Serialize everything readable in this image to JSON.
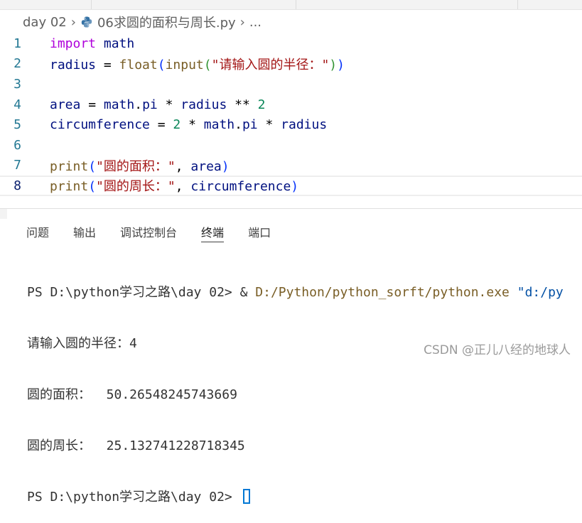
{
  "breadcrumb": {
    "folder": "day 02",
    "file": "06求圆的面积与周长.py",
    "ellipsis": "..."
  },
  "editor": {
    "current_line": 8,
    "lines": [
      {
        "number": "1"
      },
      {
        "number": "2"
      },
      {
        "number": "3"
      },
      {
        "number": "4"
      },
      {
        "number": "5"
      },
      {
        "number": "6"
      },
      {
        "number": "7"
      },
      {
        "number": "8"
      }
    ],
    "tokens": {
      "import": "import",
      "math": "math",
      "radius": "radius",
      "eq": " = ",
      "float": "float",
      "lp": "(",
      "rp": ")",
      "input": "input",
      "prompt": "\"请输入圆的半径：\"",
      "area": "area",
      "dot": ".",
      "pi": "pi",
      "times": " * ",
      "pow": " ** ",
      "two": "2",
      "circumference": "circumference",
      "print": "print",
      "label_area": "\"圆的面积：\"",
      "label_circ": "\"圆的周长：\"",
      "comma": ", ",
      "space": " "
    }
  },
  "panel": {
    "tabs": [
      "问题",
      "输出",
      "调试控制台",
      "终端",
      "端口"
    ],
    "active_tab": "终端"
  },
  "terminal": {
    "line1_prompt": "PS D:\\python学习之路\\day 02> ",
    "line1_amp": "& ",
    "line1_exe": "D:/Python/python_sorft/python.exe",
    "line1_arg": " \"d:/py",
    "line2": "请输入圆的半径：4",
    "line3": "圆的面积：  50.26548245743669",
    "line4": "圆的周长：  25.132741228718345",
    "line5_prompt": "PS D:\\python学习之路\\day 02> "
  },
  "watermark": "CSDN @正儿八经的地球人"
}
